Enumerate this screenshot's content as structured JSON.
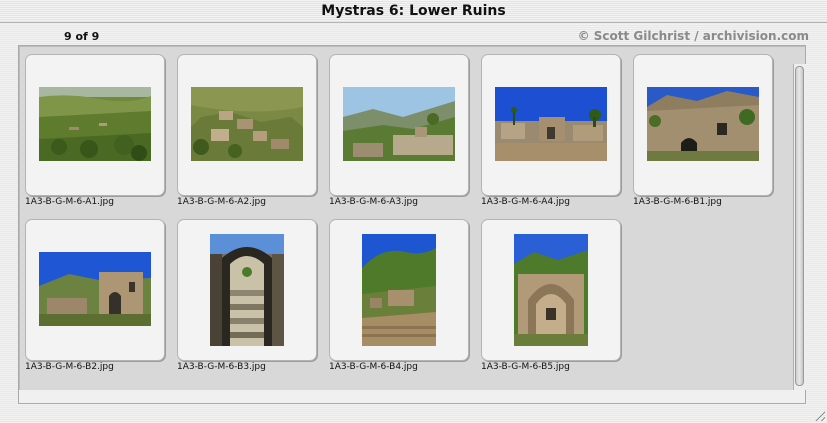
{
  "window": {
    "title": "Mystras 6: Lower Ruins"
  },
  "status": {
    "count": "9 of 9",
    "credit": "© Scott Gilchrist / archivision.com"
  },
  "thumbnails": [
    {
      "filename": "1A3-B-G-M-6-A1.jpg",
      "orientation": "landscape",
      "scene": "valley-olive-hillside"
    },
    {
      "filename": "1A3-B-G-M-6-A2.jpg",
      "orientation": "landscape",
      "scene": "hillside-ruins"
    },
    {
      "filename": "1A3-B-G-M-6-A3.jpg",
      "orientation": "landscape",
      "scene": "mountain-valley-ruins"
    },
    {
      "filename": "1A3-B-G-M-6-A4.jpg",
      "orientation": "landscape",
      "scene": "ruins-blue-sky-road"
    },
    {
      "filename": "1A3-B-G-M-6-B1.jpg",
      "orientation": "landscape",
      "scene": "stone-wall-arch"
    },
    {
      "filename": "1A3-B-G-M-6-B2.jpg",
      "orientation": "landscape",
      "scene": "fortress-ruins-sky"
    },
    {
      "filename": "1A3-B-G-M-6-B3.jpg",
      "orientation": "portrait",
      "scene": "stone-arch-passage"
    },
    {
      "filename": "1A3-B-G-M-6-B4.jpg",
      "orientation": "portrait",
      "scene": "green-hill-ruins"
    },
    {
      "filename": "1A3-B-G-M-6-B5.jpg",
      "orientation": "portrait",
      "scene": "chapel-apse-ruin"
    }
  ]
}
